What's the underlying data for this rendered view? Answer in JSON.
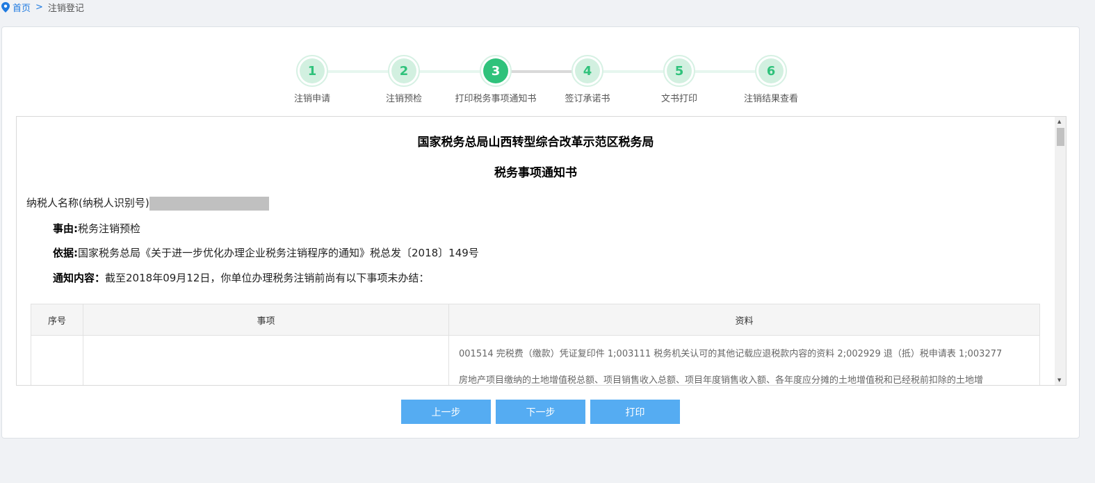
{
  "breadcrumb": {
    "home": "首页",
    "separator": ">",
    "current": "注销登记"
  },
  "steps": [
    {
      "num": "1",
      "label": "注销申请"
    },
    {
      "num": "2",
      "label": "注销预检"
    },
    {
      "num": "3",
      "label": "打印税务事项通知书"
    },
    {
      "num": "4",
      "label": "签订承诺书"
    },
    {
      "num": "5",
      "label": "文书打印"
    },
    {
      "num": "6",
      "label": "注销结果查看"
    }
  ],
  "active_step": 3,
  "doc": {
    "title": "国家税务总局山西转型综合改革示范区税务局",
    "subtitle": "税务事项通知书",
    "taxpayer_label": "纳税人名称(纳税人识别号)",
    "reason_label": "事由:",
    "reason": "税务注销预检",
    "basis_label": "依据:",
    "basis": "国家税务总局《关于进一步优化办理企业税务注销程序的通知》税总发〔2018〕149号",
    "content_label": "通知内容：",
    "content": "截至2018年09月12日，你单位办理税务注销前尚有以下事项未办结：",
    "table": {
      "headers": [
        "序号",
        "事项",
        "资料"
      ],
      "rows": [
        {
          "no": "",
          "item": "",
          "material_1": "001514 完税费（缴款）凭证复印件 1;003111 税务机关认可的其他记载应退税款内容的资料 2;002929 退（抵）税申请表 1;003277",
          "material_2": "房地产项目缴纳的土地增值税总额、项目销售收入总额、项目年度销售收入额、各年度应分摊的土地增值税和已经税前扣除的土地增"
        }
      ]
    }
  },
  "buttons": {
    "prev": "上一步",
    "next": "下一步",
    "print": "打印"
  },
  "colors": {
    "accent": "#2fc27b",
    "button": "#55acf2",
    "link": "#1f7ae0"
  }
}
